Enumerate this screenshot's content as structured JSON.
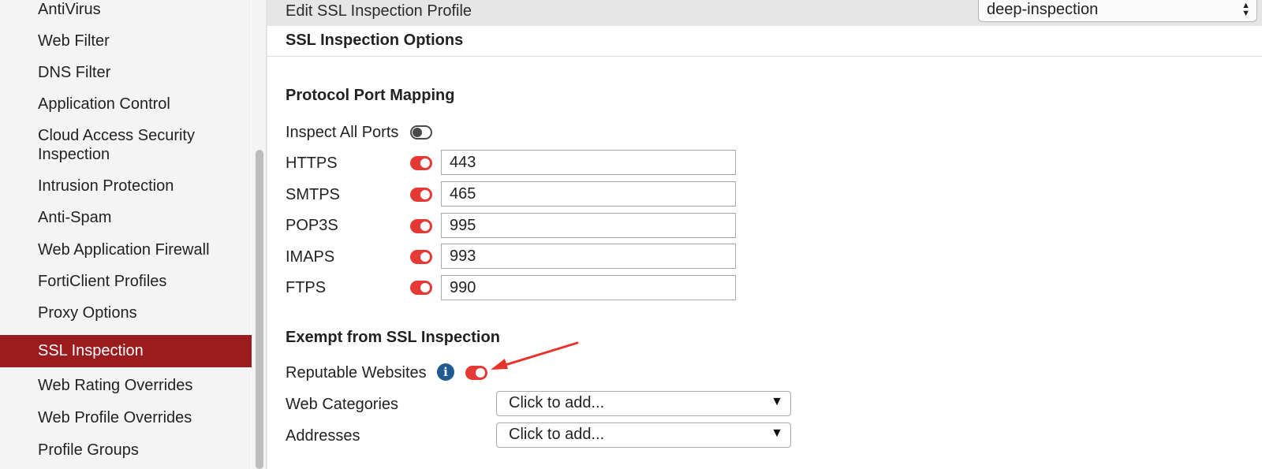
{
  "sidebar": {
    "items": [
      {
        "label": "AntiVirus"
      },
      {
        "label": "Web Filter"
      },
      {
        "label": "DNS Filter"
      },
      {
        "label": "Application Control"
      },
      {
        "label": "Cloud Access Security Inspection"
      },
      {
        "label": "Intrusion Protection"
      },
      {
        "label": "Anti-Spam"
      },
      {
        "label": "Web Application Firewall"
      },
      {
        "label": "FortiClient Profiles"
      },
      {
        "label": "Proxy Options"
      },
      {
        "label": "SSL Inspection",
        "active": true
      },
      {
        "label": "Web Rating Overrides"
      },
      {
        "label": "Web Profile Overrides"
      },
      {
        "label": "Profile Groups"
      }
    ]
  },
  "header": {
    "title": "Edit SSL Inspection Profile",
    "profile_select": "deep-inspection"
  },
  "options": {
    "title": "SSL Inspection Options"
  },
  "port_mapping": {
    "title": "Protocol Port Mapping",
    "inspect_all_label": "Inspect All Ports",
    "inspect_all_enabled": false,
    "protocols": [
      {
        "label": "HTTPS",
        "enabled": true,
        "port": "443"
      },
      {
        "label": "SMTPS",
        "enabled": true,
        "port": "465"
      },
      {
        "label": "POP3S",
        "enabled": true,
        "port": "995"
      },
      {
        "label": "IMAPS",
        "enabled": true,
        "port": "993"
      },
      {
        "label": "FTPS",
        "enabled": true,
        "port": "990"
      }
    ]
  },
  "exempt": {
    "title": "Exempt from SSL Inspection",
    "reputable_label": "Reputable Websites",
    "reputable_enabled": true,
    "web_categories_label": "Web Categories",
    "web_categories_placeholder": "Click to add...",
    "addresses_label": "Addresses",
    "addresses_placeholder": "Click to add..."
  },
  "icons": {
    "info": "info-icon",
    "dropdown_caret": "chevron-down-icon",
    "select_arrows": "updown-arrows-icon"
  },
  "colors": {
    "accent_active": "#9b1c1e",
    "toggle_on": "#e53935",
    "info_blue": "#1e5c8f",
    "annotation_arrow": "#e8332b"
  }
}
